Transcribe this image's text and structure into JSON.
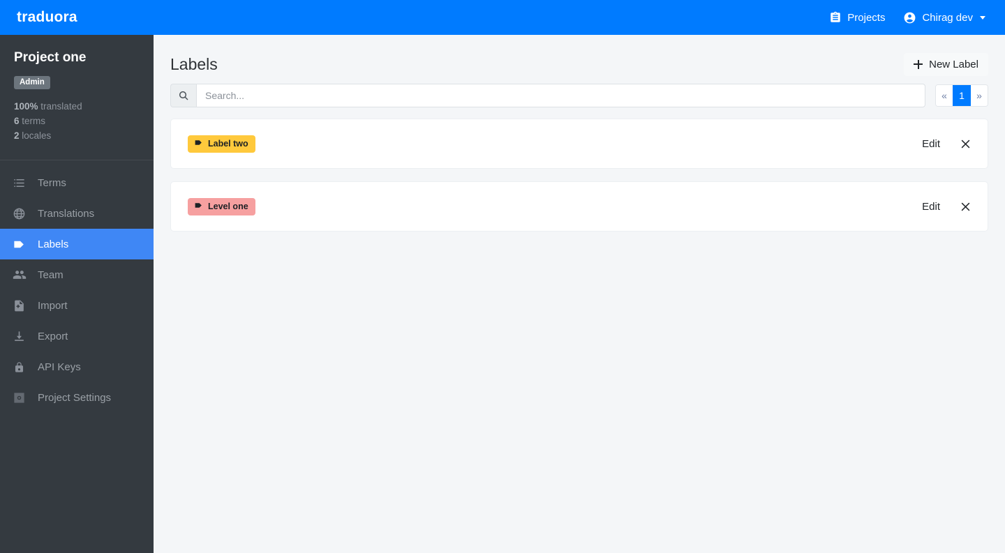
{
  "navbar": {
    "brand": "traduora",
    "projects_label": "Projects",
    "projects_icon": "clipboard-icon",
    "user_label": "Chirag dev",
    "user_icon": "account-circle-icon",
    "background_color": "#007bff"
  },
  "sidebar": {
    "project_name": "Project one",
    "role_badge": "Admin",
    "stats": [
      {
        "value": "100%",
        "label": "translated"
      },
      {
        "value": "6",
        "label": "terms"
      },
      {
        "value": "2",
        "label": "locales"
      }
    ],
    "items": [
      {
        "label": "Terms",
        "icon": "list-icon",
        "active": false
      },
      {
        "label": "Translations",
        "icon": "globe-icon",
        "active": false
      },
      {
        "label": "Labels",
        "icon": "tag-icon",
        "active": true
      },
      {
        "label": "Team",
        "icon": "people-icon",
        "active": false
      },
      {
        "label": "Import",
        "icon": "file-import-icon",
        "active": false
      },
      {
        "label": "Export",
        "icon": "download-icon",
        "active": false
      },
      {
        "label": "API Keys",
        "icon": "lock-icon",
        "active": false
      },
      {
        "label": "Project Settings",
        "icon": "gear-icon",
        "active": false
      }
    ],
    "active_color": "#3f87f5",
    "background_color": "#343a40"
  },
  "main": {
    "page_title": "Labels",
    "new_label_button": "New Label",
    "new_label_icon": "plus-icon",
    "search": {
      "placeholder": "Search...",
      "value": "",
      "icon": "search-icon"
    },
    "pagination": {
      "prev": "«",
      "next": "»",
      "current_page": "1",
      "active_color": "#007bff"
    },
    "labels": [
      {
        "name": "Label two",
        "color": "#ffc93c",
        "text_color": "#1d2125",
        "icon": "tag-icon",
        "edit_label": "Edit",
        "delete_icon": "close-icon"
      },
      {
        "name": "Level one",
        "color": "#f6a0a0",
        "text_color": "#1d2125",
        "icon": "tag-icon",
        "edit_label": "Edit",
        "delete_icon": "close-icon"
      }
    ]
  }
}
